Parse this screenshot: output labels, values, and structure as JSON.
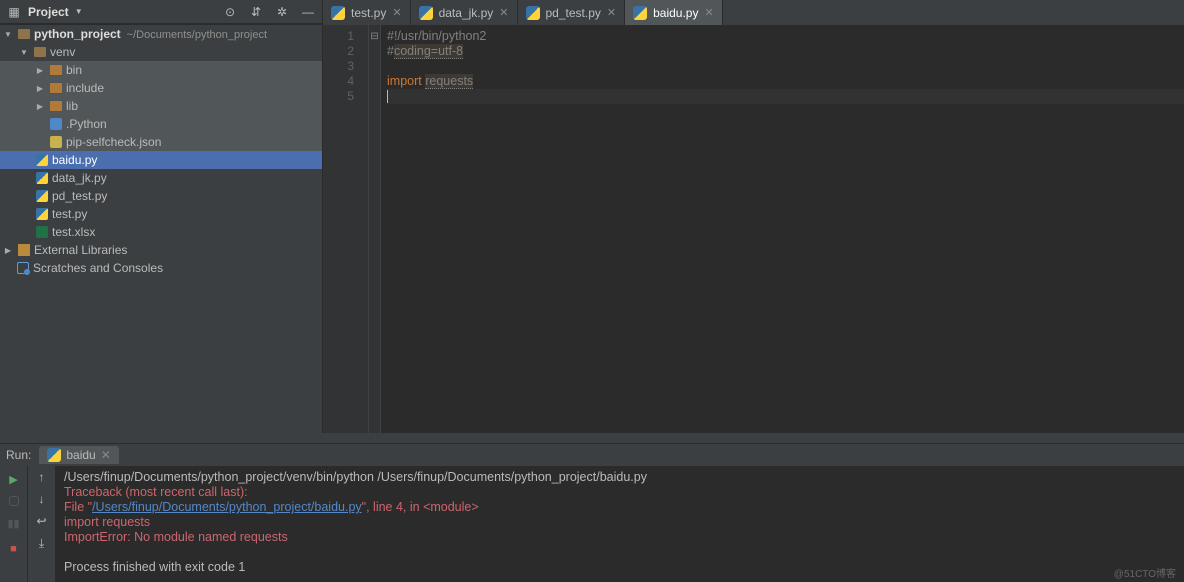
{
  "projectPanel": {
    "title": "Project",
    "root": {
      "label": "python_project",
      "hint": "~/Documents/python_project"
    },
    "venv": "venv",
    "dirs": {
      "bin": "bin",
      "include": "include",
      "lib": "lib"
    },
    "files": {
      "dotPython": ".Python",
      "pipself": "pip-selfcheck.json",
      "baidu": "baidu.py",
      "data_jk": "data_jk.py",
      "pd_test": "pd_test.py",
      "test": "test.py",
      "xlsx": "test.xlsx"
    },
    "extLib": "External Libraries",
    "scratches": "Scratches and Consoles"
  },
  "tabs": [
    {
      "label": "test.py"
    },
    {
      "label": "data_jk.py"
    },
    {
      "label": "pd_test.py"
    },
    {
      "label": "baidu.py"
    }
  ],
  "gutter": {
    "l1": "1",
    "l2": "2",
    "l3": "3",
    "l4": "4",
    "l5": "5"
  },
  "code": {
    "shebang": "#!/usr/bin/python2",
    "coding_prefix": "#",
    "coding_rest": "coding=utf-8",
    "import_kw": "import",
    "import_sp": " ",
    "import_mod": "requests"
  },
  "run": {
    "label": "Run:",
    "tab": "baidu",
    "cmd": "/Users/finup/Documents/python_project/venv/bin/python /Users/finup/Documents/python_project/baidu.py",
    "tb": "Traceback (most recent call last):",
    "file_pre": "  File \"",
    "file_link": "/Users/finup/Documents/python_project/baidu.py",
    "file_post": "\", line 4, in <module>",
    "imp": "    import requests",
    "err": "ImportError: No module named requests",
    "exit": "Process finished with exit code 1"
  },
  "watermark": "@51CTO博客"
}
